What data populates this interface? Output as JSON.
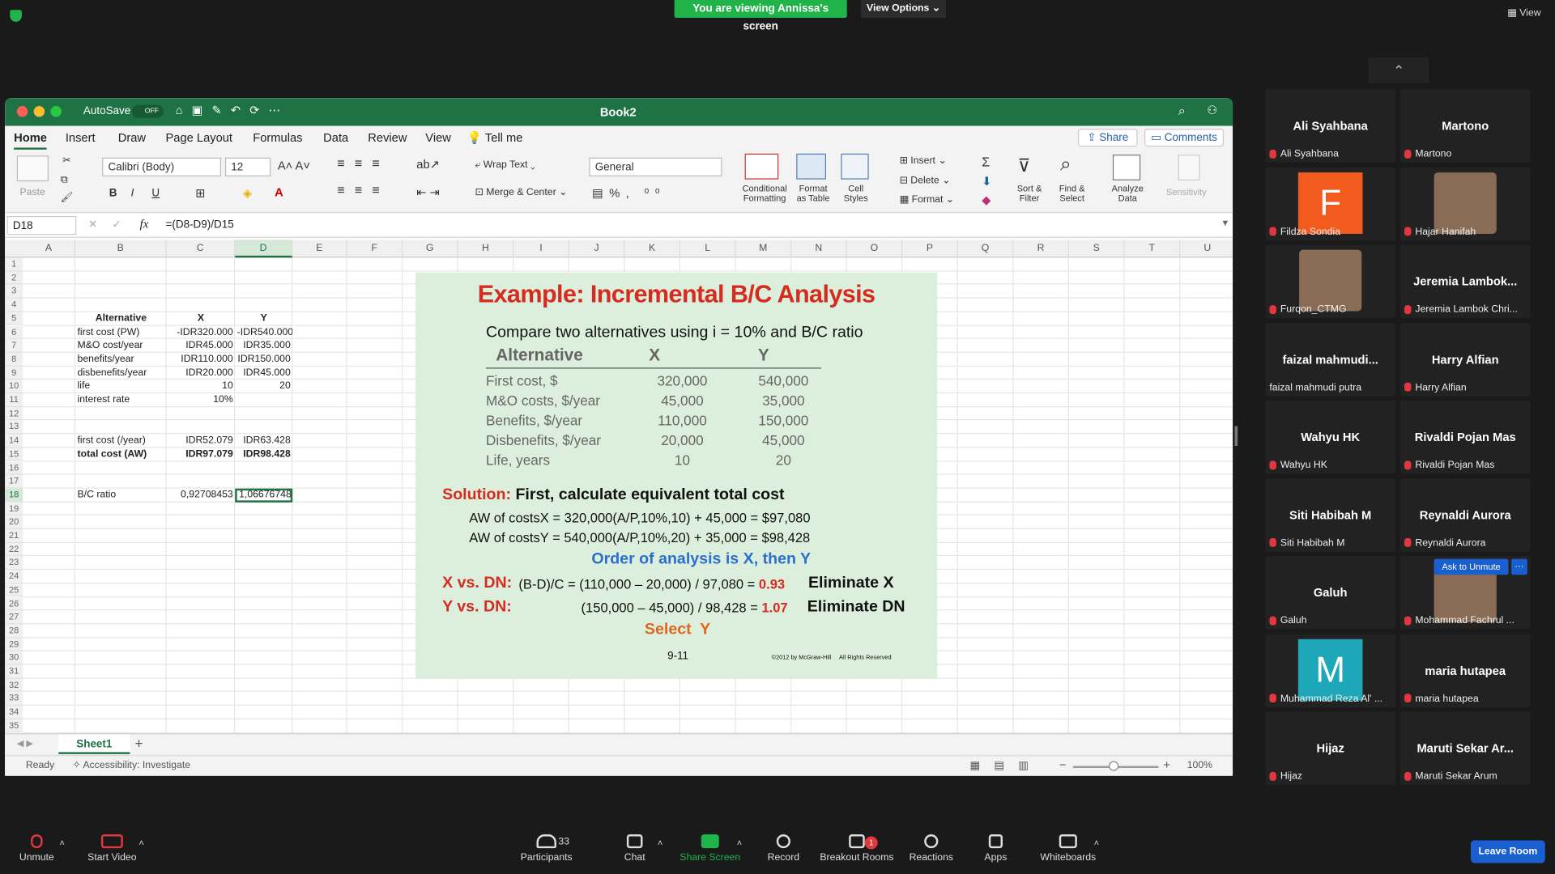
{
  "banner": {
    "text": "You are viewing Annissa's screen",
    "view_options": "View Options ⌄",
    "view": "View"
  },
  "excel": {
    "title": "Book2",
    "autosave": "AutoSave",
    "autosave_state": "OFF",
    "tabs": [
      "Home",
      "Insert",
      "Draw",
      "Page Layout",
      "Formulas",
      "Data",
      "Review",
      "View",
      "Tell me"
    ],
    "share": "Share",
    "comments": "Comments",
    "font": "Calibri (Body)",
    "font_size": "12",
    "number_format": "General",
    "wrap": "Wrap Text",
    "merge": "Merge & Center",
    "paste": "Paste",
    "insert": "Insert",
    "delete": "Delete",
    "format": "Format",
    "cond": "Conditional Formatting",
    "fmt_table": "Format as Table",
    "cell_styles": "Cell Styles",
    "sort": "Sort & Filter",
    "find": "Find & Select",
    "analyze": "Analyze Data",
    "sensitivity": "Sensitivity",
    "cell_ref": "D18",
    "formula": "=(D8-D9)/D15",
    "columns": [
      "A",
      "B",
      "C",
      "D",
      "E",
      "F",
      "G",
      "H",
      "I",
      "J",
      "K",
      "L",
      "M",
      "N",
      "O",
      "P",
      "Q",
      "R",
      "S",
      "T",
      "U"
    ],
    "cells": [
      {
        "r": 5,
        "c": "B",
        "v": "Alternative",
        "b": true,
        "a": "center"
      },
      {
        "r": 5,
        "c": "C",
        "v": "X",
        "b": true,
        "a": "center"
      },
      {
        "r": 5,
        "c": "D",
        "v": "Y",
        "b": true,
        "a": "center"
      },
      {
        "r": 6,
        "c": "B",
        "v": "first cost (PW)"
      },
      {
        "r": 6,
        "c": "C",
        "v": "-IDR320.000",
        "a": "right"
      },
      {
        "r": 6,
        "c": "D",
        "v": "-IDR540.000",
        "a": "right"
      },
      {
        "r": 7,
        "c": "B",
        "v": "M&O cost/year"
      },
      {
        "r": 7,
        "c": "C",
        "v": "IDR45.000",
        "a": "right"
      },
      {
        "r": 7,
        "c": "D",
        "v": "IDR35.000",
        "a": "right"
      },
      {
        "r": 8,
        "c": "B",
        "v": "benefits/year"
      },
      {
        "r": 8,
        "c": "C",
        "v": "IDR110.000",
        "a": "right"
      },
      {
        "r": 8,
        "c": "D",
        "v": "IDR150.000",
        "a": "right"
      },
      {
        "r": 9,
        "c": "B",
        "v": "disbenefits/year"
      },
      {
        "r": 9,
        "c": "C",
        "v": "IDR20.000",
        "a": "right"
      },
      {
        "r": 9,
        "c": "D",
        "v": "IDR45.000",
        "a": "right"
      },
      {
        "r": 10,
        "c": "B",
        "v": "life"
      },
      {
        "r": 10,
        "c": "C",
        "v": "10",
        "a": "right"
      },
      {
        "r": 10,
        "c": "D",
        "v": "20",
        "a": "right"
      },
      {
        "r": 11,
        "c": "B",
        "v": "interest rate"
      },
      {
        "r": 11,
        "c": "C",
        "v": "10%",
        "a": "right"
      },
      {
        "r": 14,
        "c": "B",
        "v": "first cost (/year)"
      },
      {
        "r": 14,
        "c": "C",
        "v": "IDR52.079",
        "a": "right"
      },
      {
        "r": 14,
        "c": "D",
        "v": "IDR63.428",
        "a": "right"
      },
      {
        "r": 15,
        "c": "B",
        "v": "total cost (AW)",
        "b": true
      },
      {
        "r": 15,
        "c": "C",
        "v": "IDR97.079",
        "a": "right",
        "b": true
      },
      {
        "r": 15,
        "c": "D",
        "v": "IDR98.428",
        "a": "right",
        "b": true
      },
      {
        "r": 18,
        "c": "B",
        "v": "B/C ratio"
      },
      {
        "r": 18,
        "c": "C",
        "v": "0,92708453",
        "a": "right"
      },
      {
        "r": 18,
        "c": "D",
        "v": "1,06676748",
        "a": "right"
      }
    ],
    "sheet": "Sheet1",
    "status": "Ready",
    "accessibility": "Accessibility: Investigate",
    "zoom": "100%"
  },
  "slide": {
    "title": "Example: Incremental B/C Analysis",
    "subtitle": "Compare two alternatives using i = 10% and B/C ratio",
    "headers": [
      "Alternative",
      "X",
      "Y"
    ],
    "rows": [
      [
        "First cost, $",
        "320,000",
        "540,000"
      ],
      [
        "M&O costs, $/year",
        "45,000",
        "35,000"
      ],
      [
        "Benefits, $/year",
        "110,000",
        "150,000"
      ],
      [
        "Disbenefits, $/year",
        "20,000",
        "45,000"
      ],
      [
        "Life, years",
        "10",
        "20"
      ]
    ],
    "solution_label": "Solution:",
    "solution_text": "First, calculate equivalent total cost",
    "aw_x": "AW of costsX = 320,000(A/P,10%,10) + 45,000 = $97,080",
    "aw_y": "AW of costsY = 540,000(A/P,10%,20) + 35,000 = $98,428",
    "order": "Order of analysis is X, then Y",
    "x_dn": "X vs. DN:",
    "x_eq": "(B-D)/C = (110,000 – 20,000) / 97,080 = ",
    "x_val": "0.93",
    "x_elim": "Eliminate X",
    "y_dn": "Y vs. DN:",
    "y_eq": "(150,000 – 45,000) / 98,428 = ",
    "y_val": "1.07",
    "y_elim": "Eliminate DN",
    "select": "Select  Y",
    "page": "9-11",
    "copyright": "©2012 by McGraw-Hill     All Rights Reserved"
  },
  "participants_panel": [
    {
      "name": "Ali Syahbana",
      "label": "Ali Syahbana"
    },
    {
      "name": "Martono",
      "label": "Martono"
    },
    {
      "name": "F",
      "label": "Fildza Sondia",
      "avatar_color": "#f25a1e"
    },
    {
      "name": "",
      "label": "Hajar Hanifah",
      "photo": true
    },
    {
      "name": "",
      "label": "Furqon_CTMG",
      "photo": true
    },
    {
      "name": "Jeremia Lambok...",
      "label": "Jeremia Lambok Chri..."
    },
    {
      "name": "faizal mahmudi...",
      "label": "faizal mahmudi putra",
      "nomic": true
    },
    {
      "name": "Harry Alfian",
      "label": "Harry Alfian"
    },
    {
      "name": "Wahyu HK",
      "label": "Wahyu HK"
    },
    {
      "name": "Rivaldi Pojan Mas",
      "label": "Rivaldi Pojan Mas"
    },
    {
      "name": "Siti Habibah M",
      "label": "Siti Habibah M"
    },
    {
      "name": "Reynaldi Aurora",
      "label": "Reynaldi Aurora"
    },
    {
      "name": "Galuh",
      "label": "Galuh"
    },
    {
      "name": "",
      "label": "Mohammad Fachrul ...",
      "photo": true,
      "ask": "Ask to Unmute"
    },
    {
      "name": "M",
      "label": "Muhammad Reza Al' ...",
      "avatar_color": "#1da7b8"
    },
    {
      "name": "maria hutapea",
      "label": "maria hutapea"
    },
    {
      "name": "Hijaz",
      "label": "Hijaz"
    },
    {
      "name": "Maruti Sekar Ar...",
      "label": "Maruti Sekar Arum"
    }
  ],
  "toolbar": {
    "unmute": "Unmute",
    "start_video": "Start Video",
    "participants": "Participants",
    "participants_count": "33",
    "chat": "Chat",
    "share": "Share Screen",
    "record": "Record",
    "breakout": "Breakout Rooms",
    "breakout_badge": "1",
    "reactions": "Reactions",
    "apps": "Apps",
    "whiteboards": "Whiteboards",
    "leave": "Leave Room"
  }
}
